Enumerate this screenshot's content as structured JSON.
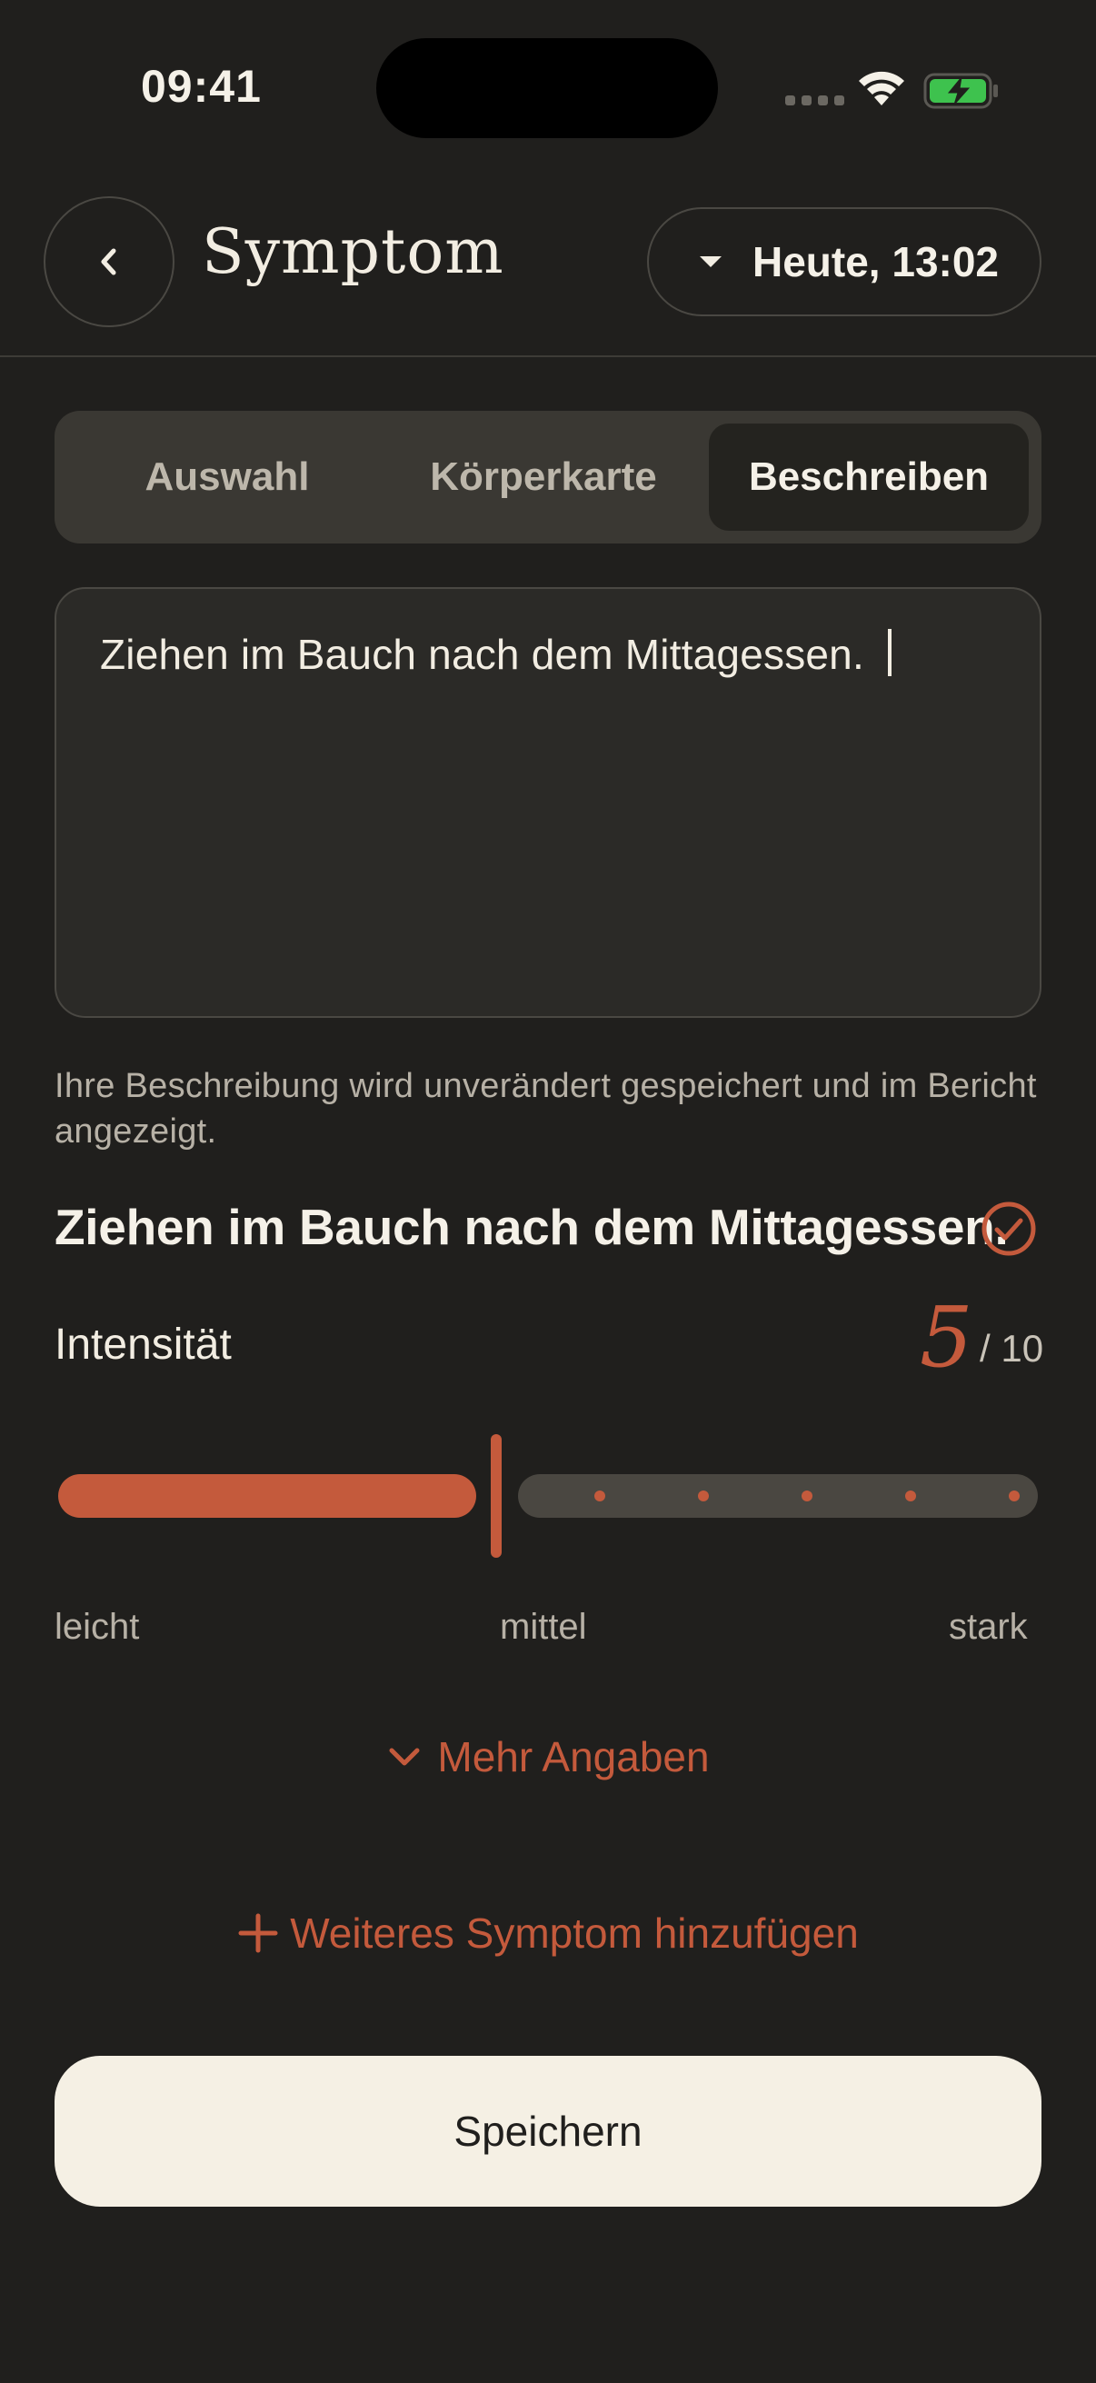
{
  "status_bar": {
    "time": "09:41"
  },
  "header": {
    "title": "Symptom",
    "date_label": "Heute, 13:02"
  },
  "tabs": [
    {
      "label": "Auswahl",
      "active": false
    },
    {
      "label": "Körperkarte",
      "active": false
    },
    {
      "label": "Beschreiben",
      "active": true
    }
  ],
  "description": {
    "value": "Ziehen im Bauch nach dem Mittagessen.",
    "helper": "Ihre Beschreibung wird unverändert gespeichert und im Bericht angezeigt."
  },
  "summary": {
    "text": "Ziehen im Bauch nach dem Mittagessen.",
    "icon": "check-circle-icon"
  },
  "intensity": {
    "label": "Intensität",
    "value": "5",
    "max": "/ 10",
    "scale_low": "leicht",
    "scale_mid": "mittel",
    "scale_high": "stark"
  },
  "actions": {
    "more": "Mehr Angaben",
    "add_symptom": "Weiteres Symptom hinzufügen",
    "save": "Speichern"
  },
  "colors": {
    "background": "#201f1d",
    "accent": "#c45a3c",
    "primary_button": "#f5f0e4",
    "text": "#f2ede2"
  }
}
